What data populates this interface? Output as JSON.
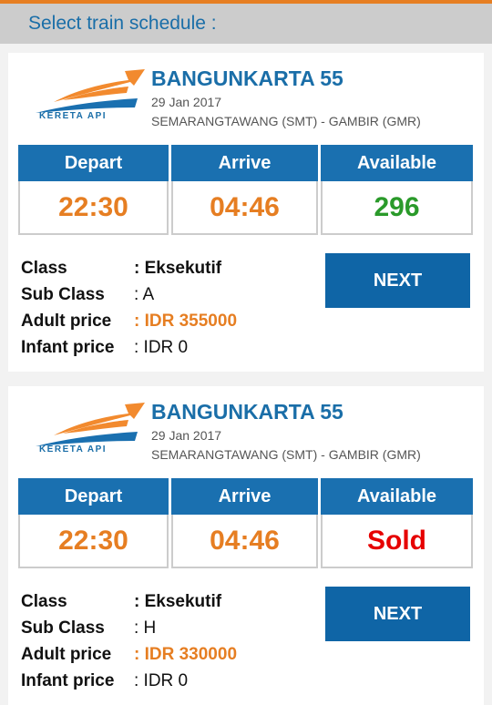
{
  "header": {
    "title": "Select train schedule :"
  },
  "colors": {
    "accent_orange": "#e67e22",
    "brand_blue": "#1a70b0",
    "available_green": "#2a9a2a",
    "sold_red": "#e60000"
  },
  "labels": {
    "depart": "Depart",
    "arrive": "Arrive",
    "available": "Available",
    "class": "Class",
    "sub_class": "Sub Class",
    "adult_price": "Adult price",
    "infant_price": "Infant price",
    "next": "NEXT",
    "logo_text": "KERETA API"
  },
  "schedules": [
    {
      "train_name": "BANGUNKARTA 55",
      "date": "29 Jan 2017",
      "route": "SEMARANGTAWANG (SMT) - GAMBIR (GMR)",
      "depart": "22:30",
      "arrive": "04:46",
      "available": "296",
      "class": ": Eksekutif",
      "sub_class": ": A",
      "adult_price": ": IDR 355000",
      "infant_price": ": IDR 0"
    },
    {
      "train_name": "BANGUNKARTA 55",
      "date": "29 Jan 2017",
      "route": "SEMARANGTAWANG (SMT) - GAMBIR (GMR)",
      "depart": "22:30",
      "arrive": "04:46",
      "available": "Sold",
      "class": ": Eksekutif",
      "sub_class": ": H",
      "adult_price": ": IDR 330000",
      "infant_price": ": IDR 0"
    }
  ]
}
